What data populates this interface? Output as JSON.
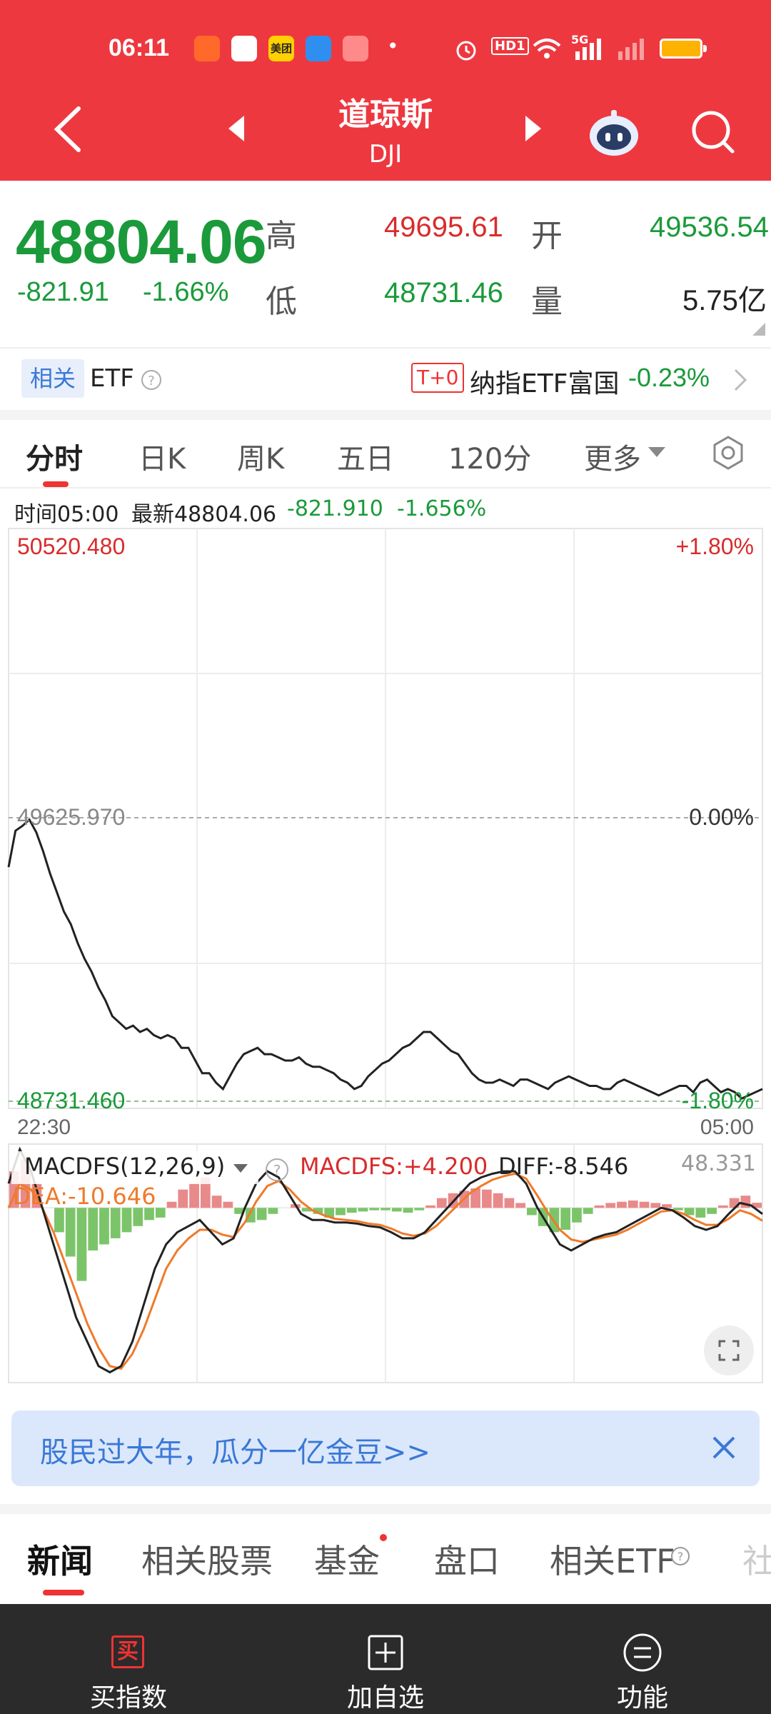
{
  "status_bar": {
    "time": "06:11",
    "app_icons": [
      "feishu-icon",
      "home-app-icon",
      "meituan-icon",
      "weather-icon",
      "video-app-icon"
    ],
    "meituan_label": "美团",
    "hd_label": "HD1",
    "network": "5G"
  },
  "nav": {
    "title": "道琼斯",
    "subtitle": "DJI"
  },
  "quote": {
    "price": "48804.06",
    "change": "-821.91",
    "change_pct": "-1.66%",
    "high_label": "高",
    "high": "49695.61",
    "low_label": "低",
    "low": "48731.46",
    "open_label": "开",
    "open": "49536.54",
    "volume_label": "量",
    "volume": "5.75亿"
  },
  "etf": {
    "tag": "相关",
    "label": "ETF",
    "t0": "T+0",
    "name": "纳指ETF富国",
    "change": "-0.23%"
  },
  "chart_tabs": [
    {
      "label": "分时",
      "active": true
    },
    {
      "label": "日K"
    },
    {
      "label": "周K"
    },
    {
      "label": "五日"
    },
    {
      "label": "120分"
    },
    {
      "label": "更多"
    }
  ],
  "info_row": {
    "time": "时间05:00",
    "latest": "最新48804.06",
    "change": "-821.910",
    "pct": "-1.656%"
  },
  "chart_data": [
    {
      "type": "line",
      "title": "",
      "y_labels_left": {
        "top": "50520.480",
        "mid": "49625.970",
        "bottom": "48731.460"
      },
      "y_labels_right": {
        "top": "+1.80%",
        "mid": "0.00%",
        "bottom": "-1.80%"
      },
      "x_labels": {
        "start": "22:30",
        "end": "05:00"
      },
      "ylim": [
        48731.46,
        50520.48
      ],
      "reference": 49625.97,
      "series": [
        {
          "values": [
            49470,
            49585,
            49600,
            49620,
            49580,
            49520,
            49450,
            49390,
            49330,
            49290,
            49230,
            49180,
            49140,
            49090,
            49050,
            49000,
            48980,
            48960,
            48970,
            48950,
            48960,
            48940,
            48930,
            48940,
            48930,
            48900,
            48900,
            48860,
            48820,
            48820,
            48790,
            48770,
            48810,
            48850,
            48880,
            48890,
            48900,
            48880,
            48880,
            48870,
            48860,
            48860,
            48870,
            48850,
            48840,
            48840,
            48830,
            48820,
            48800,
            48790,
            48770,
            48780,
            48810,
            48830,
            48850,
            48860,
            48880,
            48900,
            48910,
            48930,
            48950,
            48950,
            48930,
            48910,
            48890,
            48880,
            48850,
            48820,
            48800,
            48790,
            48790,
            48800,
            48790,
            48780,
            48800,
            48800,
            48790,
            48780,
            48770,
            48790,
            48800,
            48810,
            48800,
            48790,
            48780,
            48780,
            48770,
            48770,
            48790,
            48800,
            48790,
            48780,
            48770,
            48760,
            48750,
            48760,
            48770,
            48780,
            48780,
            48760,
            48790,
            48800,
            48780,
            48760,
            48770,
            48760,
            48740,
            48750,
            48760,
            48770
          ]
        }
      ]
    },
    {
      "type": "line",
      "title": "MACDFS(12,26,9)",
      "macdfs": "MACDFS:+4.200",
      "diff": "DIFF:-8.546",
      "dea": "DEA:-10.646",
      "max_label": "48.331",
      "series": [
        {
          "name": "DIFF",
          "values": [
            20,
            48,
            30,
            0,
            -30,
            -60,
            -90,
            -110,
            -130,
            -135,
            -130,
            -110,
            -80,
            -50,
            -30,
            -20,
            -15,
            -10,
            -20,
            -30,
            -25,
            0,
            20,
            30,
            25,
            10,
            -5,
            -10,
            -10,
            -12,
            -12,
            -13,
            -15,
            -16,
            -20,
            -25,
            -25,
            -20,
            -10,
            0,
            10,
            20,
            25,
            28,
            30,
            30,
            20,
            0,
            -15,
            -30,
            -35,
            -30,
            -25,
            -22,
            -20,
            -15,
            -10,
            -5,
            0,
            -2,
            -8,
            -15,
            -18,
            -15,
            -5,
            4,
            2,
            -5
          ]
        },
        {
          "name": "DEA",
          "values": [
            0,
            20,
            15,
            0,
            -20,
            -45,
            -70,
            -95,
            -115,
            -130,
            -132,
            -120,
            -100,
            -75,
            -50,
            -35,
            -25,
            -18,
            -18,
            -22,
            -24,
            -12,
            5,
            18,
            22,
            15,
            5,
            -2,
            -6,
            -9,
            -10,
            -11,
            -13,
            -14,
            -17,
            -21,
            -23,
            -21,
            -15,
            -6,
            3,
            12,
            18,
            23,
            26,
            28,
            24,
            10,
            -5,
            -18,
            -26,
            -28,
            -26,
            -24,
            -22,
            -18,
            -13,
            -8,
            -3,
            -2,
            -5,
            -10,
            -14,
            -14,
            -9,
            -2,
            -5,
            -10.6
          ]
        },
        {
          "name": "MACDFS",
          "values": [
            30,
            40,
            20,
            0,
            -20,
            -40,
            -60,
            -35,
            -30,
            -25,
            -20,
            -15,
            -10,
            -8,
            5,
            15,
            20,
            25,
            10,
            5,
            -5,
            -12,
            -10,
            -5,
            0,
            3,
            -3,
            -5,
            -8,
            -6,
            -4,
            -3,
            -2,
            -2,
            -3,
            -4,
            -2,
            2,
            8,
            12,
            14,
            16,
            15,
            12,
            8,
            4,
            -6,
            -15,
            -20,
            -18,
            -12,
            -5,
            2,
            4,
            5,
            6,
            5,
            4,
            3,
            -2,
            -6,
            -8,
            -5,
            2,
            8,
            10,
            4.2
          ]
        }
      ]
    }
  ],
  "banner": {
    "text": "股民过大年，瓜分一亿金豆>>"
  },
  "bottom_tabs": [
    {
      "label": "新闻",
      "active": true
    },
    {
      "label": "相关股票"
    },
    {
      "label": "基金"
    },
    {
      "label": "盘口"
    },
    {
      "label": "相关ETF"
    },
    {
      "label": "社"
    }
  ],
  "bottom_nav": [
    {
      "label": "买指数",
      "icon_char": "买"
    },
    {
      "label": "加自选"
    },
    {
      "label": "功能"
    }
  ],
  "colors": {
    "red": "#ee3840",
    "green": "#1a9a3a",
    "price_red": "#d92b2b",
    "orange": "#f07a2a",
    "blue": "#3a78d6"
  }
}
